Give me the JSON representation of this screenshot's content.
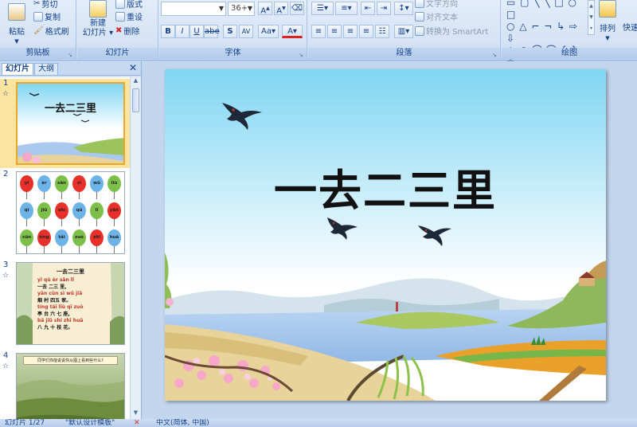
{
  "ribbon": {
    "clipboard": {
      "label": "剪贴板",
      "paste": "粘贴",
      "cut": "剪切",
      "copy": "复制",
      "format_painter": "格式刷"
    },
    "slides": {
      "label": "幻灯片",
      "new_slide": "新建\n幻灯片",
      "layout": "版式",
      "reset": "重设",
      "delete": "删除"
    },
    "font": {
      "label": "字体",
      "font_name": "",
      "font_size": "36+"
    },
    "paragraph": {
      "label": "段落",
      "text_direction": "文字方向",
      "align_text": "对齐文本",
      "convert_smartart": "转换为 SmartArt"
    },
    "drawing": {
      "label": "绘图",
      "arrange": "排列",
      "quick_styles": "快速"
    }
  },
  "left_pane": {
    "tab_slides": "幻灯片",
    "tab_outline": "大纲",
    "close": "✕",
    "thumbnails": [
      {
        "num": "1",
        "title": "一去二三里"
      },
      {
        "num": "2",
        "balloons": [
          [
            "yī",
            "èr",
            "sān",
            "sì",
            "wǔ",
            "liù"
          ],
          [
            "qī",
            "jiǔ",
            "shí",
            "qù",
            "lǐ",
            "yān"
          ],
          [
            "cūn",
            "tíng",
            "tái",
            "zuò",
            "zhī",
            "huā"
          ]
        ]
      },
      {
        "num": "3",
        "title": "一去二三里",
        "lines": [
          "yī qù èr sān lǐ",
          "一去 二三 里,",
          "yān cūn sì wǔ jiā",
          "烟 村 四五 家。",
          "tíng tái liù qī zuò",
          "亭 台 六 七 座,",
          "bā jiǔ shí zhī huā",
          "八 九 十 枝 花。"
        ]
      },
      {
        "num": "4",
        "caption": "同学们你能说说你从图上看到些什么?"
      }
    ]
  },
  "slide": {
    "title": "一去二三里"
  },
  "status": {
    "slide_counter": "幻灯片 1/27",
    "theme": "\"默认设计模板\"",
    "language": "中文(简体, 中国)"
  },
  "colors": {
    "sky_top": "#7fd6f3",
    "sky_bottom": "#ffffff",
    "water": "#a9c9ef",
    "sand": "#e8d49a",
    "balloon_red": "#e8302a",
    "balloon_blue": "#6cb4e8",
    "balloon_green": "#7cc04a"
  }
}
